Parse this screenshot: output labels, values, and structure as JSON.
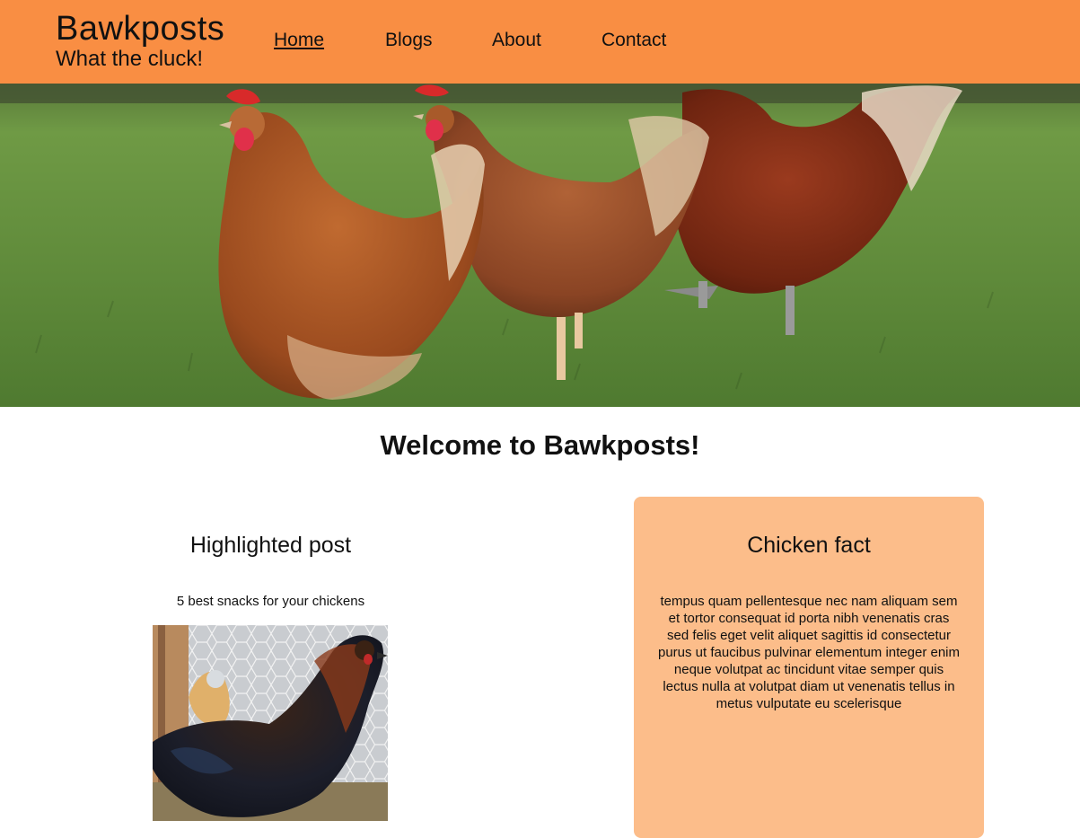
{
  "header": {
    "site_title": "Bawkposts",
    "tagline": "What the cluck!",
    "nav": [
      {
        "label": "Home",
        "active": true
      },
      {
        "label": "Blogs",
        "active": false
      },
      {
        "label": "About",
        "active": false
      },
      {
        "label": "Contact",
        "active": false
      }
    ],
    "background_color": "#f98e43"
  },
  "hero": {
    "icon": "chickens-photo"
  },
  "main": {
    "welcome_heading": "Welcome to Bawkposts!",
    "highlighted": {
      "heading": "Highlighted post",
      "post_title": "5 best snacks for your chickens"
    },
    "fact": {
      "heading": "Chicken fact",
      "text": "tempus quam pellentesque nec nam aliquam sem et tortor consequat id porta nibh venenatis cras sed felis eget velit aliquet sagittis id consectetur purus ut faucibus pulvinar elementum integer enim neque volutpat ac tincidunt vitae semper quis lectus nulla at volutpat diam ut venenatis tellus in metus vulputate eu scelerisque",
      "background_color": "#fcbd8a"
    }
  }
}
